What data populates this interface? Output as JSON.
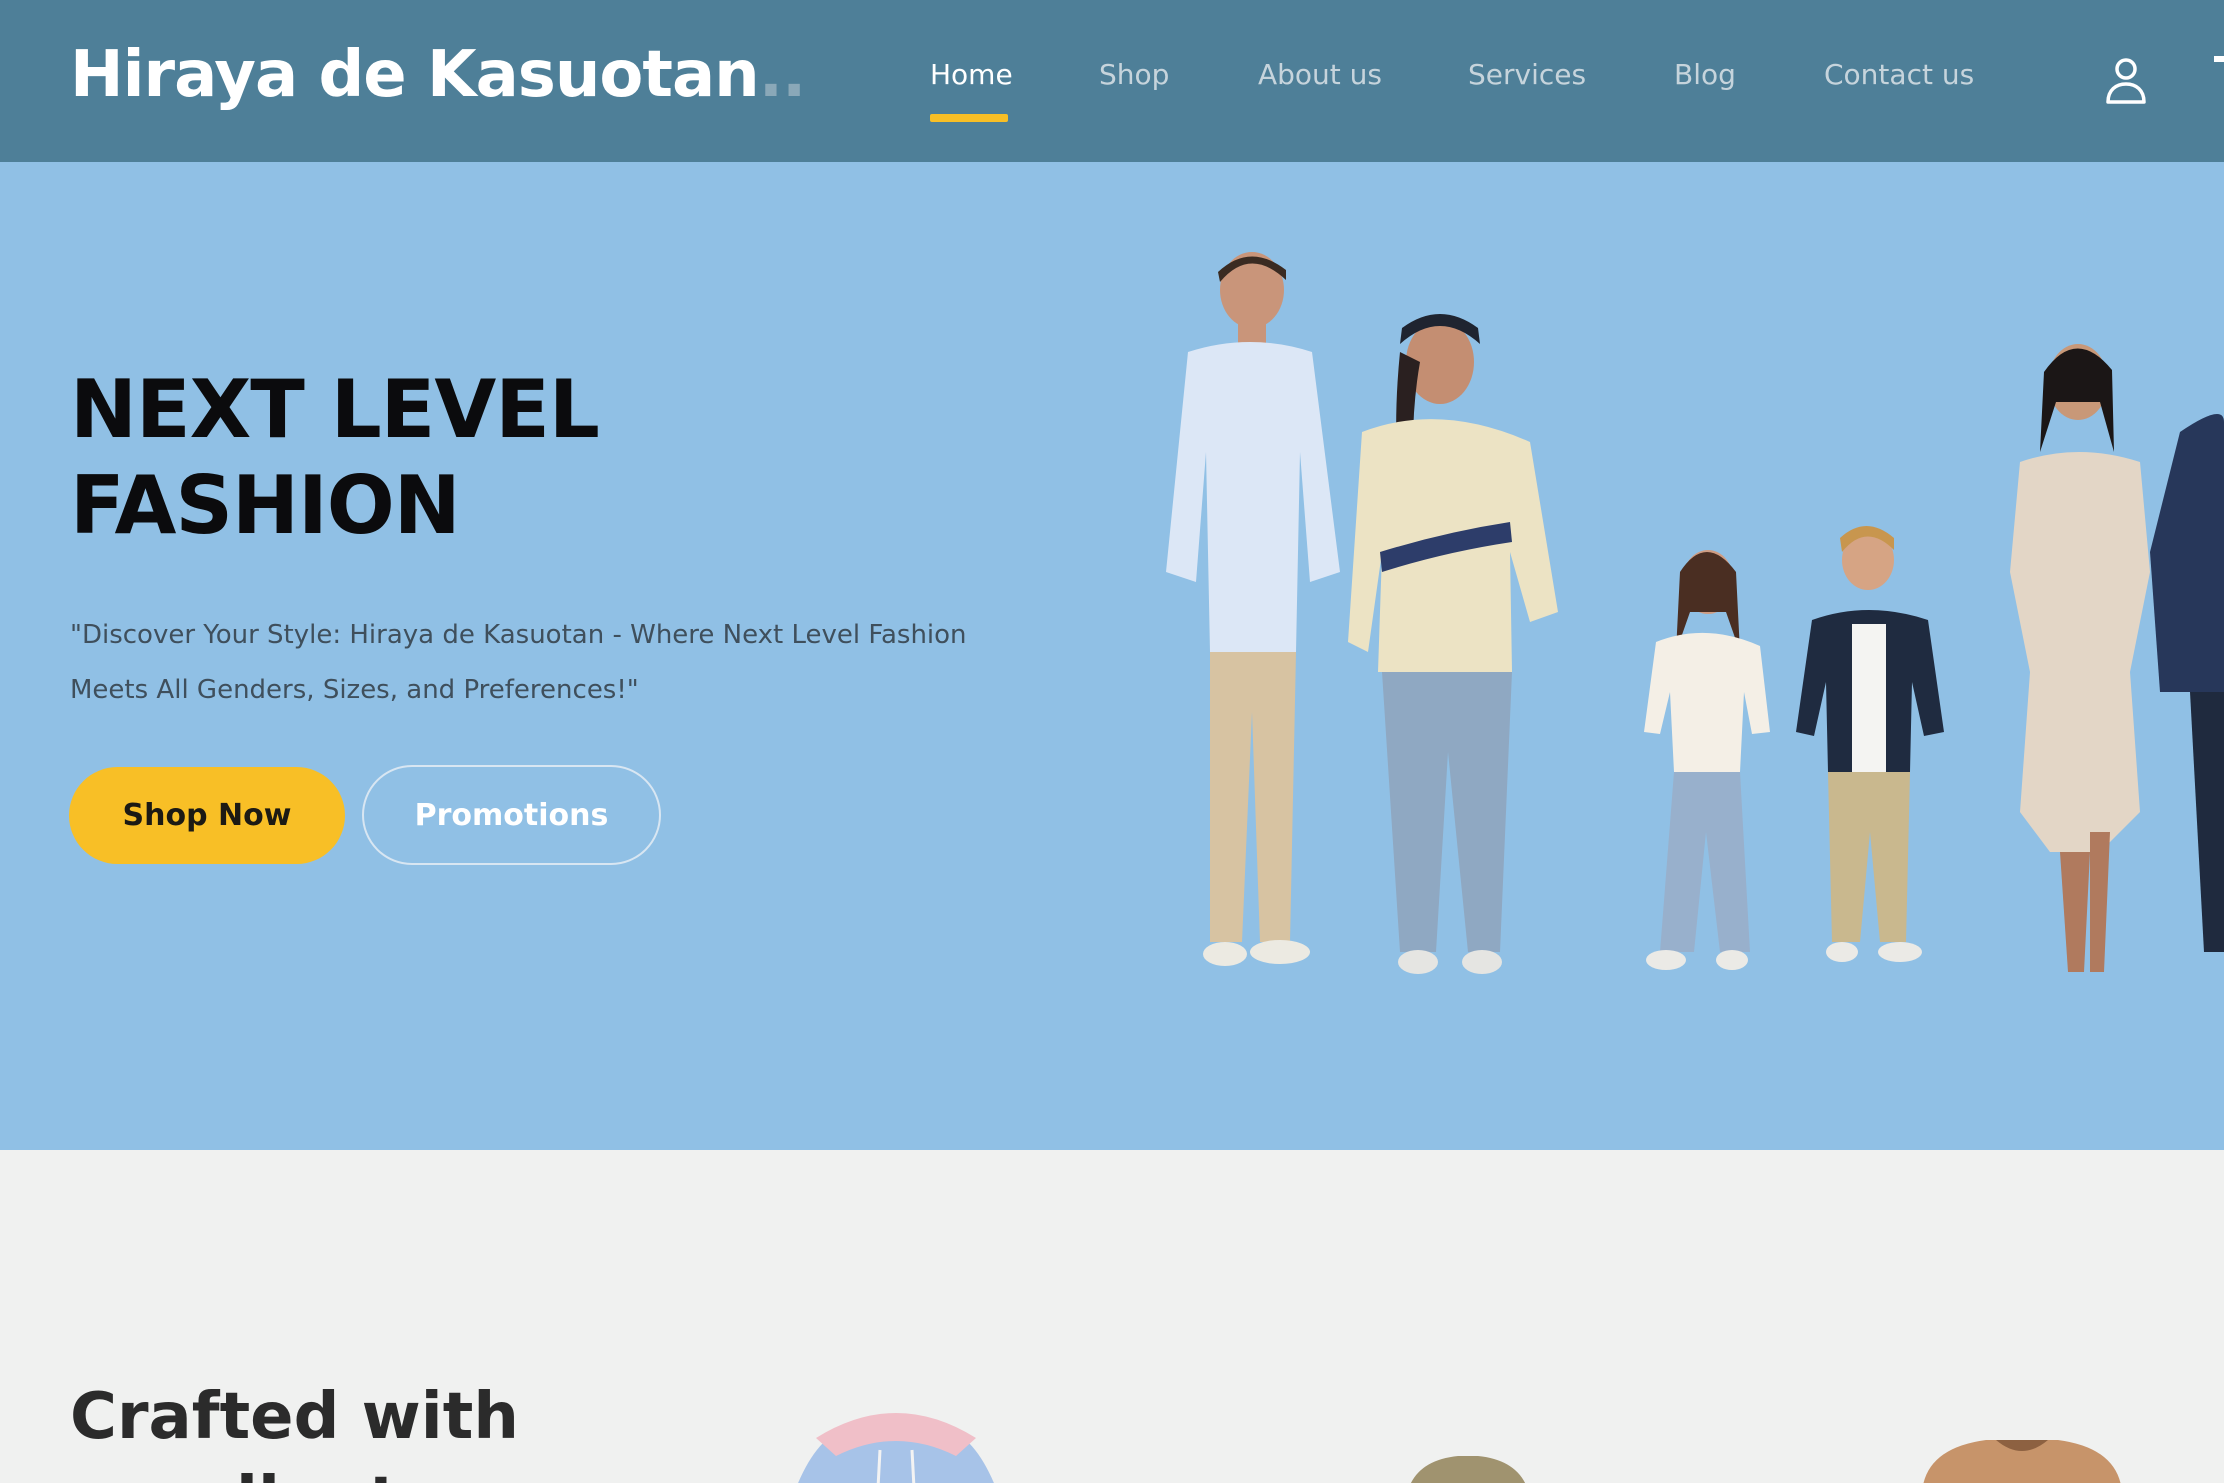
{
  "header": {
    "brand": "Hiraya de Kasuotan",
    "brand_dots": "..",
    "nav": [
      {
        "label": "Home",
        "active": true
      },
      {
        "label": "Shop",
        "active": false
      },
      {
        "label": "About us",
        "active": false
      },
      {
        "label": "Services",
        "active": false
      },
      {
        "label": "Blog",
        "active": false
      },
      {
        "label": "Contact us",
        "active": false
      }
    ],
    "icons": [
      "user-icon",
      "cart-icon"
    ]
  },
  "hero": {
    "title_line1": "NEXT LEVEL",
    "title_line2": "FASHION",
    "description": "\"Discover Your Style: Hiraya de Kasuotan - Where Next Level Fashion Meets All Genders, Sizes, and Preferences!\"",
    "primary_button": "Shop Now",
    "secondary_button": "Promotions"
  },
  "section2": {
    "heading_line1": "Crafted with",
    "heading_line2": "excellent"
  },
  "colors": {
    "navbar": "#4e7f98",
    "hero_bg": "#90c0e5",
    "accent": "#f8bf26",
    "page_bg": "#f0f1f0"
  }
}
